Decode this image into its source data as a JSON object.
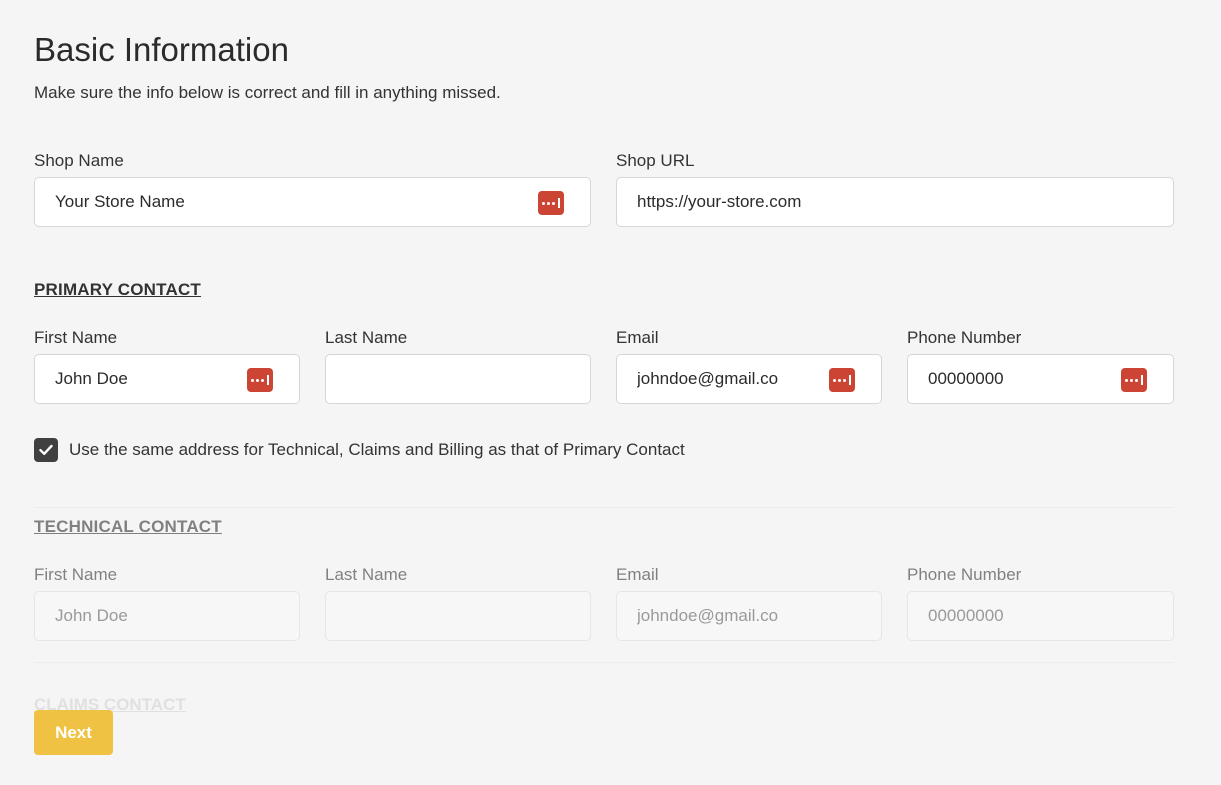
{
  "header": {
    "title": "Basic Information",
    "subtitle": "Make sure the info below is correct and fill in anything missed."
  },
  "shop": {
    "name_label": "Shop Name",
    "name_value": "Your Store Name",
    "url_label": "Shop URL",
    "url_value": "https://your-store.com"
  },
  "primary_contact": {
    "title": "PRIMARY CONTACT",
    "first_name_label": "First Name",
    "first_name_value": "John Doe",
    "last_name_label": "Last Name",
    "last_name_value": "",
    "email_label": "Email",
    "email_value": "johndoe@gmail.co",
    "phone_label": "Phone Number",
    "phone_value": "00000000"
  },
  "same_address": {
    "checked": true,
    "label": "Use the same address for Technical, Claims and Billing as that of Primary Contact"
  },
  "technical_contact": {
    "title": "TECHNICAL CONTACT",
    "first_name_label": "First Name",
    "first_name_value": "John Doe",
    "last_name_label": "Last Name",
    "last_name_value": "",
    "email_label": "Email",
    "email_value": "johndoe@gmail.co",
    "phone_label": "Phone Number",
    "phone_value": "00000000"
  },
  "claims_contact": {
    "title": "CLAIMS CONTACT"
  },
  "actions": {
    "next_label": "Next"
  },
  "colors": {
    "accent": "#f0c244",
    "password_manager_icon": "#cc4433",
    "checkbox": "#404040",
    "background": "#f5f5f5"
  },
  "icons": {
    "password_manager": "password-manager-icon",
    "check": "checkmark-icon"
  }
}
